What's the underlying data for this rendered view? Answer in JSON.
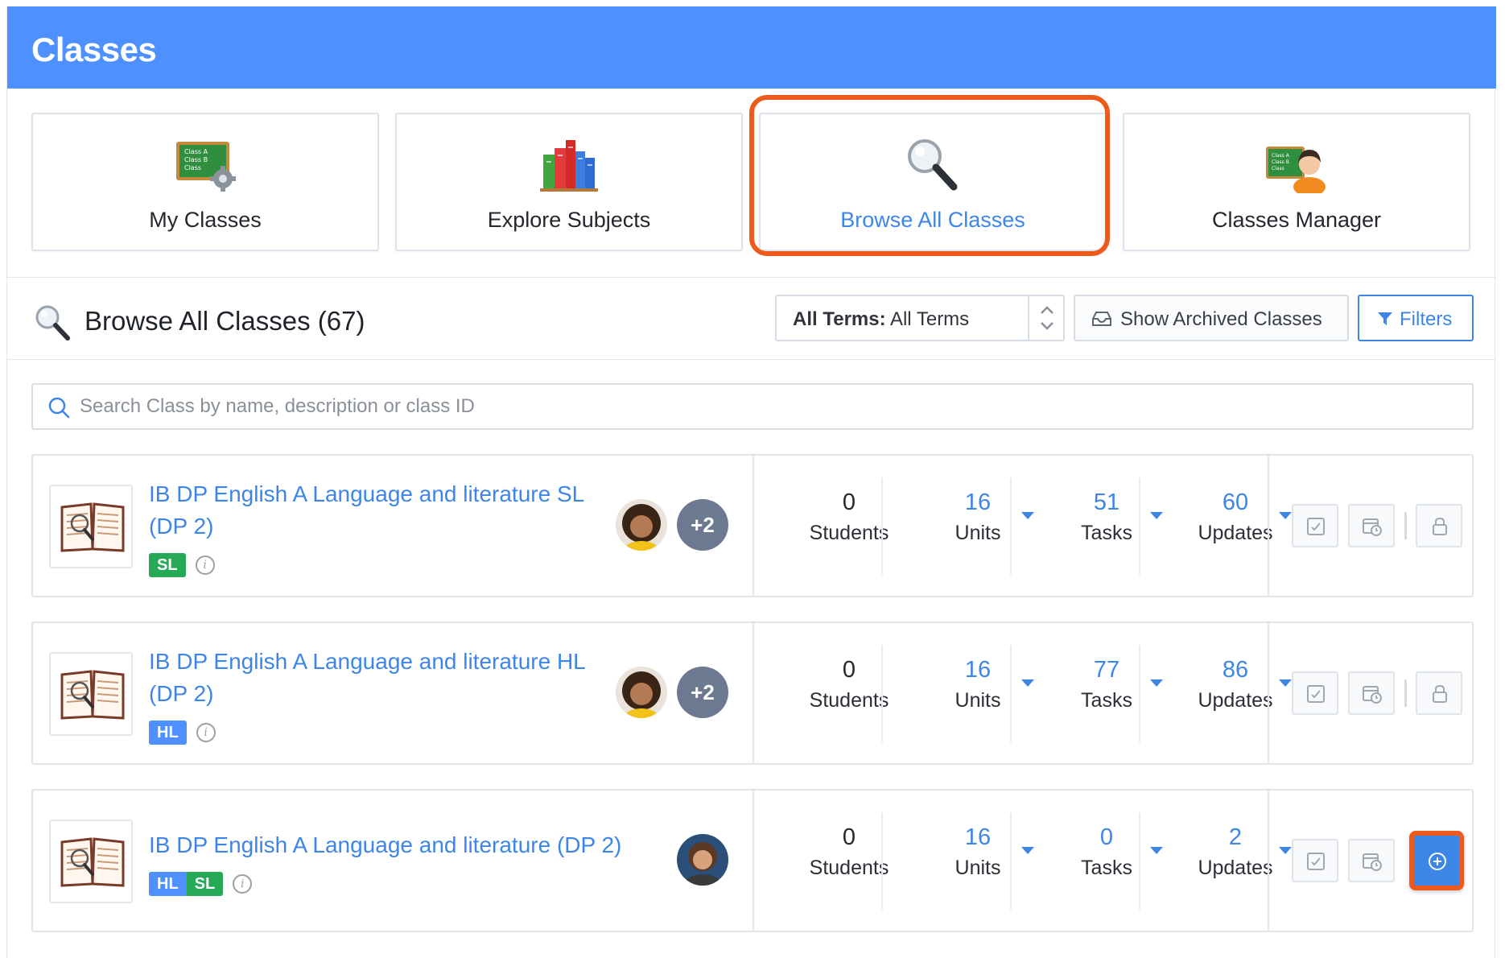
{
  "header": {
    "title": "Classes"
  },
  "nav_cards": [
    {
      "label": "My Classes",
      "icon": "class-board-gear-icon"
    },
    {
      "label": "Explore Subjects",
      "icon": "books-icon"
    },
    {
      "label": "Browse All Classes",
      "icon": "magnifier-icon",
      "active": true
    },
    {
      "label": "Classes Manager",
      "icon": "class-board-teacher-icon"
    }
  ],
  "icon_texts": {
    "board_line1": "Class A",
    "board_line2": "Class B",
    "board_line3": "Class"
  },
  "toolbar": {
    "title": "Browse All Classes (67)",
    "term_label": "All Terms:",
    "term_value": "All Terms",
    "archived_label": "Show Archived Classes",
    "filters_label": "Filters"
  },
  "search": {
    "placeholder": "Search Class by name, description or class ID",
    "value": ""
  },
  "classes": [
    {
      "name": "IB DP English A Language and literature SL (DP 2)",
      "tags": [
        "SL"
      ],
      "extra_teachers": "+2",
      "students": "0",
      "students_label": "Students",
      "units": "16",
      "units_label": "Units",
      "tasks": "51",
      "tasks_label": "Tasks",
      "updates": "60",
      "updates_label": "Updates",
      "action": "locked"
    },
    {
      "name": "IB DP English A Language and literature HL (DP 2)",
      "tags": [
        "HL"
      ],
      "extra_teachers": "+2",
      "students": "0",
      "students_label": "Students",
      "units": "16",
      "units_label": "Units",
      "tasks": "77",
      "tasks_label": "Tasks",
      "updates": "86",
      "updates_label": "Updates",
      "action": "locked"
    },
    {
      "name": "IB DP English A Language and literature (DP 2)",
      "tags": [
        "HL",
        "SL"
      ],
      "extra_teachers": "",
      "students": "0",
      "students_label": "Students",
      "units": "16",
      "units_label": "Units",
      "tasks": "0",
      "tasks_label": "Tasks",
      "updates": "2",
      "updates_label": "Updates",
      "action": "join"
    }
  ],
  "colors": {
    "header": "#4d90fe",
    "accent": "#3d86e8",
    "highlight": "#ee5a1b",
    "sl_tag": "#26a957",
    "hl_tag": "#4d90fe"
  }
}
